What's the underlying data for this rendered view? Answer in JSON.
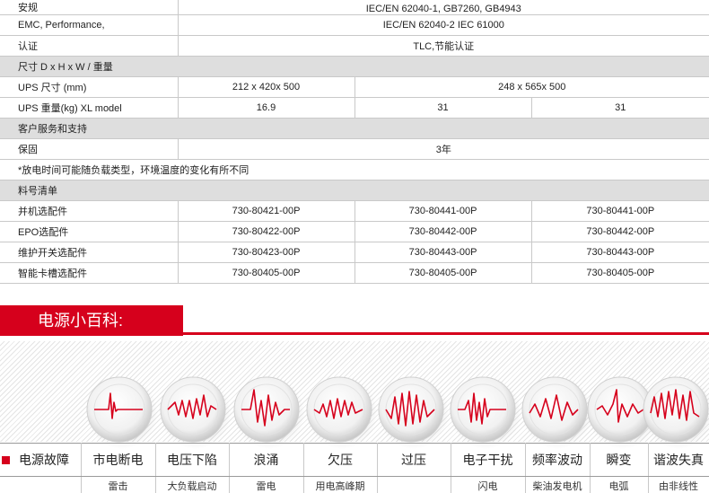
{
  "spec": {
    "rows": [
      {
        "type": "row",
        "label": "安规",
        "cells": [
          {
            "text": "IEC/EN 62040-1, GB7260, GB4943",
            "span": 3
          }
        ]
      },
      {
        "type": "row",
        "label": "EMC, Performance,",
        "cells": [
          {
            "text": "IEC/EN 62040-2  IEC 61000",
            "span": 3
          }
        ]
      },
      {
        "type": "row",
        "label": "认证",
        "cells": [
          {
            "text": "TLC,节能认证",
            "span": 3
          }
        ]
      },
      {
        "type": "section",
        "label": "尺寸 D x H x W / 重量"
      },
      {
        "type": "row",
        "label": "UPS 尺寸 (mm)",
        "cells": [
          {
            "text": "212 x 420x 500",
            "span": 1
          },
          {
            "text": "248 x 565x 500",
            "span": 2
          }
        ]
      },
      {
        "type": "row",
        "label": "UPS 重量(kg) XL model",
        "cells": [
          {
            "text": "16.9",
            "span": 1
          },
          {
            "text": "31",
            "span": 1
          },
          {
            "text": "31",
            "span": 1
          }
        ]
      },
      {
        "type": "section",
        "label": "客户服务和支持"
      },
      {
        "type": "row",
        "label": "保固",
        "cells": [
          {
            "text": "3年",
            "span": 3
          }
        ]
      },
      {
        "type": "note",
        "label": "*放电时间可能随负载类型，环境温度的变化有所不同"
      },
      {
        "type": "section",
        "label": "料号清单"
      },
      {
        "type": "row",
        "label": "并机选配件",
        "cells": [
          {
            "text": "730-80421-00P",
            "span": 1
          },
          {
            "text": "730-80441-00P",
            "span": 1
          },
          {
            "text": "730-80441-00P",
            "span": 1
          }
        ]
      },
      {
        "type": "row",
        "label": "EPO选配件",
        "cells": [
          {
            "text": "730-80422-00P",
            "span": 1
          },
          {
            "text": "730-80442-00P",
            "span": 1
          },
          {
            "text": "730-80442-00P",
            "span": 1
          }
        ]
      },
      {
        "type": "row",
        "label": "维护开关选配件",
        "cells": [
          {
            "text": "730-80423-00P",
            "span": 1
          },
          {
            "text": "730-80443-00P",
            "span": 1
          },
          {
            "text": "730-80443-00P",
            "span": 1
          }
        ]
      },
      {
        "type": "row",
        "label": "智能卡槽选配件",
        "cells": [
          {
            "text": "730-80405-00P",
            "span": 1
          },
          {
            "text": "730-80405-00P",
            "span": 1
          },
          {
            "text": "730-80405-00P",
            "span": 1
          }
        ]
      }
    ]
  },
  "banner": {
    "title": "电源小百科:",
    "color": "#d6001c"
  },
  "faults": {
    "icons": [
      "outage-waveform-icon",
      "sag-waveform-icon",
      "surge-waveform-icon",
      "undervoltage-waveform-icon",
      "overvoltage-waveform-icon",
      "noise-waveform-icon",
      "frequency-variation-waveform-icon",
      "transient-waveform-icon",
      "harmonic-distortion-waveform-icon"
    ],
    "headers": [
      "电源故障",
      "市电断电",
      "电压下陷",
      "浪涌",
      "欠压",
      "过压",
      "电子干扰",
      "频率波动",
      "瞬变",
      "谐波失真"
    ],
    "details": [
      "",
      "雷击",
      "大负载启动",
      "雷电",
      "用电高峰期",
      "",
      "闪电",
      "柴油发电机",
      "电弧",
      "由非线性"
    ]
  }
}
